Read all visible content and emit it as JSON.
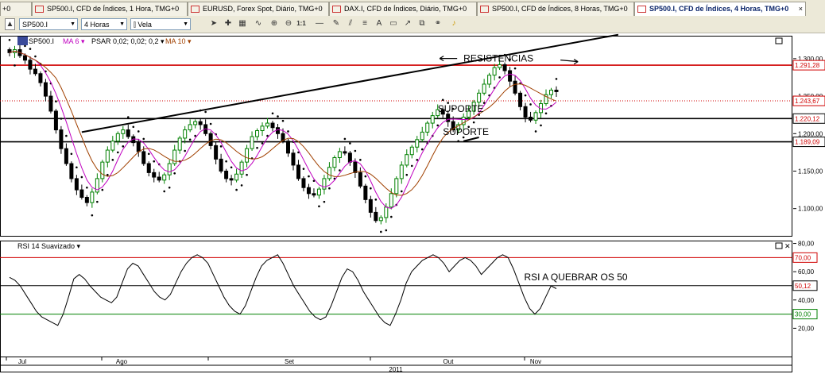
{
  "tabs": [
    {
      "label": "+0"
    },
    {
      "label": "SP500.I, CFD de Índices, 1 Hora, TMG+0"
    },
    {
      "label": "EURUSD, Forex Spot, Diário, TMG+0"
    },
    {
      "label": "DAX.I, CFD de Índices, Diário, TMG+0"
    },
    {
      "label": "SP500.I, CFD de Índices, 8 Horas, TMG+0"
    },
    {
      "label": "SP500.I, CFD de Índices, 4 Horas, TMG+0",
      "active": true
    }
  ],
  "tab_close": "×",
  "toolbar": {
    "symbol": "SP500.I",
    "timeframe": "4 Horas",
    "chart_type": "Vela",
    "zoom_label": "1:1"
  },
  "chart_data": [
    {
      "type": "candlestick",
      "symbol": "SP500.I",
      "timeframe": "4 Horas",
      "indicator_labels": {
        "symbol": "SP500.I",
        "ma6": "MA 6",
        "psar": "PSAR 0,02; 0,02; 0,2",
        "ma10": "MA 10"
      },
      "y_range": [
        1070,
        1320
      ],
      "y_ticks": [
        {
          "value": 1300,
          "label": "1.300,00"
        },
        {
          "value": 1250,
          "label": "1.250,00"
        },
        {
          "value": 1200,
          "label": "1.200,00"
        },
        {
          "value": 1150,
          "label": "1.150,00"
        },
        {
          "value": 1100,
          "label": "1.100,00"
        }
      ],
      "x_labels": [
        "Jul",
        "Ago",
        "Set",
        "Out",
        "Nov"
      ],
      "year_label": "2011",
      "horizontal_levels": [
        {
          "value": 1291.28,
          "label": "1.291,28",
          "color": "#d00000",
          "style": "solid"
        },
        {
          "value": 1243.67,
          "label": "1.243,67",
          "color": "#d00000",
          "style": "dotted"
        },
        {
          "value": 1220.12,
          "label": "1.220,12",
          "color": "#000000",
          "style": "solid"
        },
        {
          "value": 1189.09,
          "label": "1.189,09",
          "color": "#000000",
          "style": "solid"
        }
      ],
      "close_series": [
        1308,
        1312,
        1304,
        1298,
        1286,
        1280,
        1268,
        1250,
        1230,
        1205,
        1180,
        1160,
        1140,
        1125,
        1115,
        1108,
        1122,
        1140,
        1162,
        1178,
        1190,
        1200,
        1205,
        1196,
        1188,
        1176,
        1160,
        1148,
        1142,
        1138,
        1145,
        1160,
        1178,
        1194,
        1205,
        1212,
        1216,
        1212,
        1200,
        1184,
        1166,
        1150,
        1140,
        1138,
        1146,
        1162,
        1180,
        1196,
        1204,
        1210,
        1214,
        1208,
        1200,
        1190,
        1174,
        1158,
        1140,
        1128,
        1120,
        1118,
        1126,
        1140,
        1155,
        1168,
        1176,
        1174,
        1162,
        1148,
        1130,
        1112,
        1095,
        1084,
        1088,
        1102,
        1120,
        1140,
        1158,
        1172,
        1182,
        1192,
        1202,
        1214,
        1224,
        1232,
        1226,
        1216,
        1205,
        1212,
        1222,
        1230,
        1242,
        1254,
        1266,
        1278,
        1288,
        1292,
        1284,
        1270,
        1254,
        1236,
        1222,
        1218,
        1228,
        1240,
        1252,
        1258,
        1256
      ],
      "trendlines": [
        {
          "from": {
            "i": 14,
            "value": 1202
          },
          "to": {
            "i": 118,
            "value": 1332
          },
          "color": "#000000"
        },
        {
          "from": {
            "i": 88,
            "value": 1190
          },
          "to": {
            "i": 91,
            "value": 1195
          },
          "color": "#000000"
        }
      ],
      "annotations": [
        {
          "text": "RESISTENCIAS",
          "i": 88,
          "value": 1296
        },
        {
          "text": "SUPORTE",
          "i": 83,
          "value": 1229
        },
        {
          "text": "SUPORTE",
          "i": 84,
          "value": 1198
        }
      ]
    },
    {
      "type": "line",
      "title": "RSI 14 Suavizado",
      "y_range": [
        0,
        82
      ],
      "y_ticks": [
        {
          "value": 80,
          "label": "80,00"
        },
        {
          "value": 60,
          "label": "60,00"
        },
        {
          "value": 40,
          "label": "40,00"
        },
        {
          "value": 20,
          "label": "20,00"
        }
      ],
      "levels": [
        {
          "value": 70,
          "label": "70,00",
          "color": "#d00000"
        },
        {
          "value": 50.12,
          "label": "50,12",
          "color": "#000000"
        },
        {
          "value": 30,
          "label": "30,00",
          "color": "#008000"
        }
      ],
      "values": [
        56,
        54,
        50,
        44,
        38,
        32,
        28,
        26,
        24,
        22,
        30,
        42,
        55,
        58,
        55,
        50,
        46,
        42,
        40,
        38,
        42,
        52,
        62,
        66,
        64,
        58,
        52,
        46,
        42,
        40,
        44,
        52,
        60,
        66,
        70,
        72,
        70,
        66,
        58,
        50,
        42,
        36,
        32,
        30,
        36,
        46,
        56,
        64,
        68,
        70,
        72,
        66,
        58,
        50,
        44,
        38,
        32,
        28,
        26,
        28,
        36,
        46,
        56,
        62,
        60,
        54,
        46,
        40,
        34,
        28,
        24,
        22,
        30,
        40,
        52,
        60,
        64,
        68,
        70,
        72,
        70,
        66,
        60,
        64,
        68,
        70,
        68,
        64,
        58,
        62,
        66,
        70,
        72,
        70,
        62,
        52,
        42,
        34,
        30,
        34,
        42,
        50,
        48
      ],
      "annotation": {
        "text": "RSI A QUEBRAR OS 50",
        "i": 96,
        "value": 54
      }
    }
  ],
  "colors": {
    "up_candle": "#008000",
    "down_candle": "#000000",
    "ma6": "#c000c0",
    "ma10": "#a04000",
    "psar": "#000000",
    "rsi_line": "#000000"
  }
}
